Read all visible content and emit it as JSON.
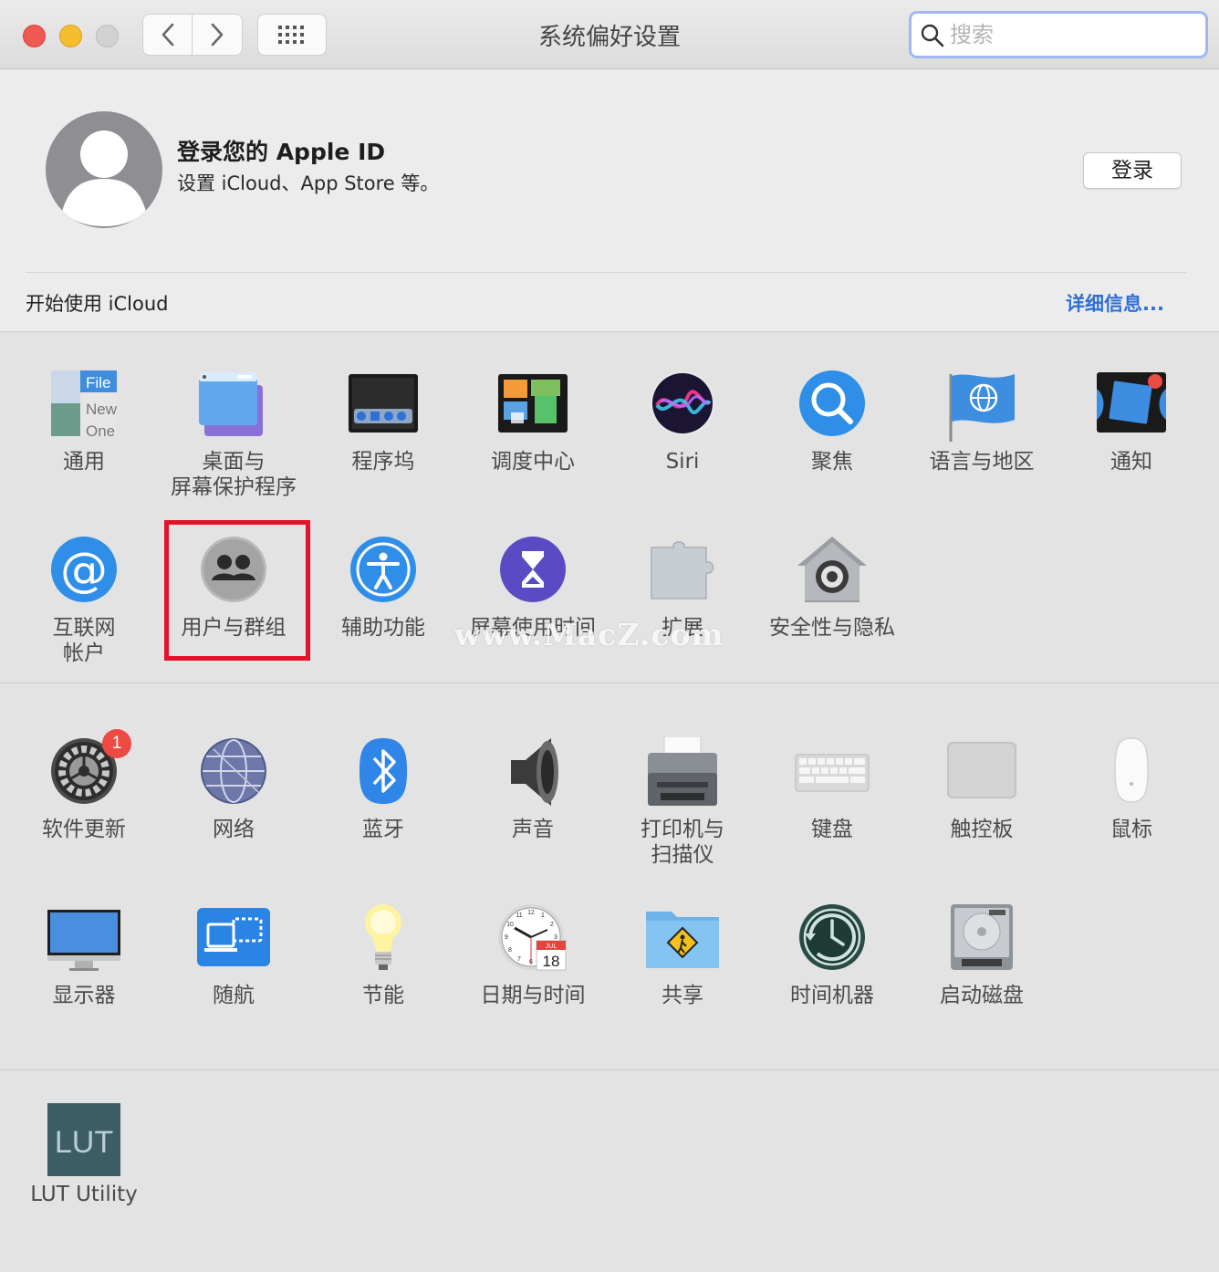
{
  "window": {
    "title": "系统偏好设置"
  },
  "search": {
    "placeholder": "搜索"
  },
  "account": {
    "title": "登录您的 Apple ID",
    "subtitle": "设置 iCloud、App Store 等。",
    "signin_label": "登录"
  },
  "icloud_bar": {
    "label": "开始使用 iCloud",
    "details_label": "详细信息..."
  },
  "row1": [
    "通用",
    "桌面与\n屏幕保护程序",
    "程序坞",
    "调度中心",
    "Siri",
    "聚焦",
    "语言与地区",
    "通知"
  ],
  "row2": [
    "互联网\n帐户",
    "用户与群组",
    "辅助功能",
    "屏幕使用时间",
    "扩展",
    "安全性与隐私"
  ],
  "row3": [
    "软件更新",
    "网络",
    "蓝牙",
    "声音",
    "打印机与\n扫描仪",
    "键盘",
    "触控板",
    "鼠标"
  ],
  "row4": [
    "显示器",
    "随航",
    "节能",
    "日期与时间",
    "共享",
    "时间机器",
    "启动磁盘"
  ],
  "row5": [
    "LUT Utility"
  ],
  "software_update_badge": "1",
  "watermark": "www.MacZ.com",
  "icon_text": {
    "general_file": "File",
    "general_new": "New",
    "general_one": "One",
    "date_month": "JUL",
    "date_day": "18",
    "lut": "LUT"
  },
  "clock_numbers": [
    "12",
    "1",
    "2",
    "3",
    "4",
    "5",
    "6",
    "7",
    "8",
    "9",
    "10",
    "11"
  ],
  "colors": {
    "accent": "#2f6fd6",
    "highlight": "#e4122c",
    "badge": "#ec4a43"
  }
}
